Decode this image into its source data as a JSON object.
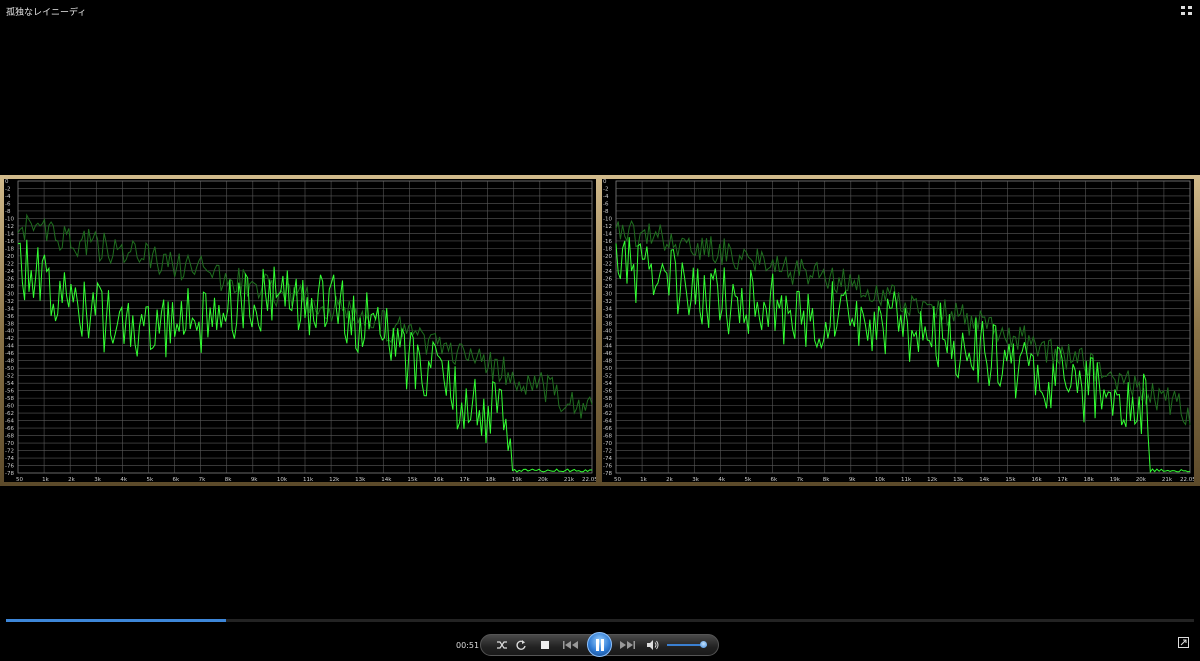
{
  "window": {
    "title": "孤独なレイニーディ"
  },
  "player": {
    "elapsed": "00:51",
    "progress_fraction": 0.185,
    "volume_fraction": 0.9,
    "state": "playing"
  },
  "visualizer": {
    "y_ticks": [
      "0",
      "-2",
      "-4",
      "-6",
      "-8",
      "-10",
      "-12",
      "-14",
      "-16",
      "-18",
      "-20",
      "-22",
      "-24",
      "-26",
      "-28",
      "-30",
      "-32",
      "-34",
      "-36",
      "-38",
      "-40",
      "-42",
      "-44",
      "-46",
      "-48",
      "-50",
      "-52",
      "-54",
      "-56",
      "-58",
      "-60",
      "-62",
      "-64",
      "-66",
      "-68",
      "-70",
      "-72",
      "-74",
      "-76",
      "-78"
    ],
    "x_ticks": [
      "50",
      "1k",
      "2k",
      "3k",
      "4k",
      "5k",
      "6k",
      "7k",
      "8k",
      "9k",
      "10k",
      "11k",
      "12k",
      "13k",
      "14k",
      "15k",
      "16k",
      "17k",
      "18k",
      "19k",
      "20k",
      "21k",
      "22.05k"
    ],
    "trace_color": "#33ff33",
    "peak_color": "#1f6e1f",
    "grid_color": "#585858",
    "channels": [
      {
        "name": "left"
      },
      {
        "name": "right"
      }
    ]
  },
  "icons": {
    "view_toggle": "grid-icon",
    "shuffle": "shuffle-icon",
    "repeat": "repeat-icon",
    "stop": "stop-icon",
    "previous": "previous-icon",
    "play_pause": "pause-icon",
    "next": "next-icon",
    "volume": "volume-icon",
    "fullscreen": "fullscreen-icon"
  },
  "colors": {
    "accent": "#3d86d8",
    "frame": "#c8b083"
  }
}
